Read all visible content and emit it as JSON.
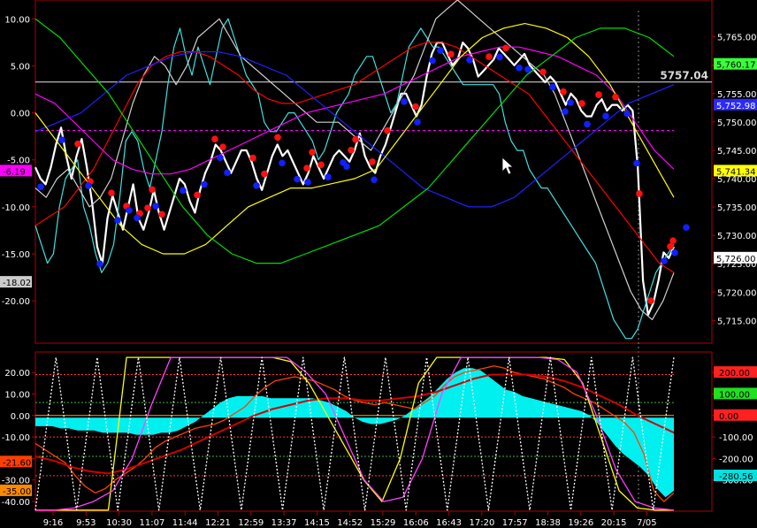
{
  "chart_data": [
    {
      "type": "line",
      "panel": "price",
      "left_axis": {
        "ticks": [
          "10.00",
          "5.00",
          "0.00",
          "-5.00",
          "-10.00",
          "-15.00",
          "-20.00"
        ],
        "values": [
          10,
          5,
          0,
          -5,
          -10,
          -15,
          -20
        ],
        "range": [
          -24.5,
          12
        ]
      },
      "right_axis": {
        "ticks": [
          "5,765.00",
          "5,760.00",
          "5,755.00",
          "5,750.00",
          "5,745.00",
          "5,740.00",
          "5,735.00",
          "5,730.00",
          "5,725.00",
          "5,720.00",
          "5,715.00"
        ],
        "values": [
          5765,
          5760,
          5755,
          5750,
          5745,
          5740,
          5735,
          5730,
          5725,
          5720,
          5715
        ],
        "range": [
          5711,
          5771.5
        ]
      },
      "x_ticks": [
        "9:16",
        "9:53",
        "10:30",
        "11:07",
        "11:44",
        "12:21",
        "12:59",
        "13:37",
        "14:15",
        "14:52",
        "15:29",
        "16:06",
        "16:43",
        "17:20",
        "17:57",
        "18:38",
        "19:26",
        "20:15",
        "7/05"
      ],
      "reference_level": 5757.04,
      "dashed_level": 5748.5,
      "value_labels": [
        {
          "text": "5757.04",
          "color": "#d8d8d8",
          "value": 5757.04,
          "boxed": false
        },
        {
          "text": "5,760.17",
          "color": "#3aff3a",
          "value": 5760.17
        },
        {
          "text": "5,752.98",
          "color": "#2a2aff",
          "value": 5752.98
        },
        {
          "text": "5,741.34",
          "color": "#ffff00",
          "value": 5741.34
        },
        {
          "text": "5,726.00",
          "color": "#ffffff",
          "value": 5726.0
        }
      ],
      "left_labels": [
        {
          "text": "-6.19",
          "color": "#ff00ff",
          "value": -6.19
        },
        {
          "text": "-18.02",
          "color": "#cccccc",
          "value": -18.02
        }
      ],
      "series": [
        {
          "color": "#ffffff",
          "role": "price",
          "values": [
            5742,
            5740,
            5739,
            5742,
            5746,
            5749,
            5744,
            5740,
            5744,
            5747,
            5742,
            5736,
            5728,
            5725,
            5733,
            5737,
            5734,
            5731,
            5735,
            5739,
            5733,
            5731,
            5734,
            5738,
            5734,
            5731,
            5734,
            5737,
            5740,
            5739,
            5736,
            5734,
            5738,
            5741,
            5743,
            5746,
            5745,
            5743,
            5741,
            5743,
            5745,
            5745,
            5743,
            5740,
            5738,
            5741,
            5744,
            5746,
            5744,
            5745,
            5743,
            5741,
            5739,
            5741,
            5744,
            5742,
            5740,
            5742,
            5744,
            5745,
            5744,
            5743,
            5745,
            5748,
            5744,
            5742,
            5741,
            5744,
            5746,
            5749,
            5752,
            5755,
            5755,
            5753,
            5751,
            5753,
            5758,
            5762,
            5764,
            5764,
            5762,
            5760,
            5761,
            5764,
            5763,
            5761,
            5758,
            5759,
            5760,
            5761,
            5763,
            5762,
            5761,
            5760,
            5761,
            5762,
            5760,
            5759,
            5758,
            5757,
            5758,
            5757,
            5755,
            5753,
            5755,
            5754,
            5752,
            5751,
            5751,
            5753,
            5754,
            5752,
            5753,
            5753,
            5752,
            5753,
            5752,
            5742,
            5722,
            5716,
            5718,
            5722,
            5727,
            5726,
            5728
          ]
        },
        {
          "color": "#40e0e0",
          "role": "left-scale",
          "values": [
            -12,
            -14,
            -16,
            -15,
            -10,
            -7,
            -6,
            -5,
            -10,
            -12,
            -15,
            -17,
            -16,
            -14,
            -9,
            -3,
            -2,
            -3,
            -6,
            -8,
            -5,
            -2,
            3,
            7,
            9,
            6,
            4,
            7,
            5,
            3,
            6,
            9,
            10,
            8,
            6,
            4,
            3,
            2,
            -1,
            -2,
            -2,
            -1,
            0,
            0,
            -1,
            -2,
            -3,
            -5,
            -4,
            -2,
            0,
            1,
            2,
            4,
            5,
            6,
            6,
            4,
            2,
            0,
            1,
            4,
            7,
            8,
            9,
            8,
            7,
            7,
            6,
            5,
            4,
            3,
            3,
            3,
            3,
            3,
            3,
            2,
            -1,
            -3,
            -4,
            -4,
            -6,
            -7,
            -8,
            -8,
            -9,
            -10,
            -11,
            -12,
            -13,
            -14,
            -15,
            -16,
            -18,
            -20,
            -22,
            -23,
            -24,
            -24,
            -23,
            -21,
            -19,
            -17,
            -16,
            -15,
            -14
          ]
        },
        {
          "color": "#d0d0d0",
          "role": "left-scale",
          "values": [
            -8,
            -9,
            -7,
            -6,
            -8,
            -10,
            -9,
            -7,
            -3,
            1,
            4,
            6,
            5,
            3,
            5,
            8,
            9,
            10,
            8,
            6,
            5,
            4,
            3,
            2,
            1,
            0,
            -1,
            -1,
            -1,
            -2,
            -3,
            -4,
            -2,
            0,
            2,
            4,
            7,
            10,
            11,
            12,
            11,
            10,
            9,
            8,
            7,
            6,
            5,
            4,
            2,
            -1,
            -4,
            -7,
            -10,
            -13,
            -16,
            -19,
            -21,
            -22,
            -20,
            -17
          ]
        },
        {
          "color": "#ff0000",
          "role": "left-scale",
          "values": [
            -12,
            -11,
            -10,
            -8,
            -6,
            -3,
            0,
            3,
            5,
            6,
            6.5,
            6.5,
            6,
            5,
            4,
            2.5,
            1.5,
            1,
            1,
            1.5,
            2,
            2.5,
            3,
            4,
            5,
            6,
            7,
            7.5,
            7.5,
            7,
            6,
            5,
            4,
            3,
            2,
            0,
            -2,
            -4,
            -6,
            -8,
            -10,
            -12,
            -14,
            -16,
            -17
          ]
        },
        {
          "color": "#ff00ff",
          "role": "left-scale",
          "values": [
            2,
            1,
            -1,
            -3,
            -5,
            -6,
            -6.5,
            -6.5,
            -6,
            -5,
            -4,
            -3,
            -2,
            -1,
            0,
            0.5,
            1,
            1.5,
            2,
            3,
            4,
            5,
            6,
            6.5,
            7,
            7,
            6.5,
            6,
            5,
            4,
            2,
            -1,
            -4,
            -6
          ]
        },
        {
          "color": "#2020ff",
          "role": "left-scale",
          "values": [
            -2,
            -1,
            0,
            2,
            4,
            5,
            6,
            6.5,
            6.5,
            6,
            5,
            4,
            2,
            0,
            -2,
            -4,
            -6,
            -8,
            -9,
            -10,
            -10,
            -9,
            -7,
            -5,
            -3,
            -1,
            1,
            2,
            3
          ]
        },
        {
          "color": "#ffff00",
          "role": "left-scale",
          "values": [
            0,
            -3,
            -6,
            -9,
            -12,
            -14,
            -15,
            -15,
            -14,
            -12,
            -10,
            -9,
            -8,
            -8,
            -7.5,
            -7,
            -6,
            -3,
            0,
            3,
            6,
            8,
            9,
            9.5,
            9,
            8,
            6,
            3,
            -1,
            -5,
            -9
          ]
        },
        {
          "color": "#00dd00",
          "role": "left-scale",
          "values": [
            10,
            8,
            5,
            2,
            -2,
            -6,
            -10,
            -13,
            -15,
            -16,
            -16,
            -15,
            -14,
            -13,
            -12,
            -10,
            -8,
            -5,
            -2,
            1,
            4,
            6,
            8,
            9,
            9,
            8,
            6
          ]
        }
      ],
      "markers_red_highs": [
        48,
        62,
        86,
        103,
        118,
        127,
        132,
        143,
        183,
        203,
        212,
        246,
        259,
        274,
        307,
        313,
        323,
        357,
        362,
        381,
        398,
        430,
        470,
        513,
        532,
        574,
        597,
        618,
        637,
        656,
        683,
        696,
        718,
        721
      ],
      "markers_blue_lows": [
        6,
        30,
        60,
        73,
        93,
        106,
        115,
        136,
        167,
        191,
        209,
        217,
        250,
        279,
        296,
        308,
        331,
        348,
        352,
        383,
        417,
        432,
        449,
        458,
        491,
        525,
        547,
        557,
        585,
        599,
        605,
        624,
        645,
        669,
        680,
        711,
        723,
        736
      ]
    },
    {
      "type": "line",
      "panel": "oscillator",
      "left_axis": {
        "ticks": [
          "20.00",
          "10.00",
          "0.00",
          "-10.00",
          "-20.00",
          "-30.00",
          "-40.00"
        ],
        "values": [
          20,
          10,
          0,
          -10,
          -20,
          -30,
          -40
        ],
        "range": [
          -44.5,
          29.5
        ]
      },
      "right_axis": {
        "ticks": [
          "200.00",
          "100.00",
          "0.00",
          "-100.00",
          "-200.00",
          "-300.00"
        ],
        "values": [
          200,
          100,
          0,
          -100,
          -200,
          -300
        ]
      },
      "reference_lines": [
        {
          "color": "#ffa500",
          "value": 0
        },
        {
          "color": "#ff3333",
          "value": 19,
          "dotted": true
        },
        {
          "color": "#ff3333",
          "value": -10,
          "dotted": true
        },
        {
          "color": "#ff3333",
          "value": -28,
          "dotted": true
        },
        {
          "color": "#40b040",
          "value": 6,
          "dotted": true
        },
        {
          "color": "#40b040",
          "value": -19,
          "dotted": true
        }
      ],
      "value_labels": [
        {
          "text": "200.00",
          "color": "#ff2020",
          "value": 200
        },
        {
          "text": "100.00",
          "color": "#20e020",
          "value": 100
        },
        {
          "text": "0.00",
          "color": "#ff2020",
          "value": 0
        },
        {
          "text": "-280.56",
          "color": "#00e0e0",
          "value": -280.56
        }
      ],
      "left_labels": [
        {
          "text": "-21.60",
          "color": "#ff4000",
          "value": -21.6
        },
        {
          "text": "-35.00",
          "color": "#ff8800",
          "value": -35
        }
      ],
      "histogram_cyan": [
        -5,
        -5,
        -5,
        -6,
        -6,
        -7,
        -7,
        -7,
        -8,
        -8,
        -8,
        -8,
        -9,
        -9,
        -9,
        -8,
        -8,
        -7,
        -5,
        -3,
        0,
        3,
        6,
        8,
        9,
        9,
        9,
        9,
        8,
        8,
        8,
        8,
        8,
        8,
        7,
        6,
        4,
        2,
        -1,
        -3,
        -4,
        -4,
        -3,
        -2,
        0,
        3,
        6,
        9,
        13,
        17,
        20,
        22,
        22,
        21,
        18,
        15,
        12,
        11,
        9,
        8,
        7,
        6,
        5,
        4,
        3,
        2,
        0,
        -4,
        -9,
        -14,
        -18,
        -21,
        -24,
        -28,
        -34,
        -38,
        -35
      ],
      "series": [
        {
          "color": "#ff4000",
          "role": "momentum",
          "values": [
            -13,
            -16,
            -19,
            -22,
            -28,
            -33,
            -36,
            -34,
            -30,
            -27,
            -24,
            -20,
            -15,
            -12,
            -10,
            -8,
            -6,
            -5,
            -4,
            -2,
            1,
            4,
            9,
            13,
            16,
            17,
            18,
            17,
            16,
            14,
            12,
            9,
            7,
            6,
            5,
            6,
            5,
            4,
            3,
            6,
            9,
            14,
            18,
            20,
            21,
            22,
            23,
            22,
            20,
            19,
            18,
            17,
            15,
            13,
            10,
            8,
            6,
            3,
            0,
            -3,
            -8,
            -18,
            -35,
            -40,
            -36
          ]
        },
        {
          "color": "#d00000",
          "role": "smooth",
          "values": [
            -19,
            -21,
            -24,
            -26,
            -27,
            -25,
            -22,
            -19,
            -16,
            -12,
            -8,
            -4,
            0,
            3,
            5,
            7,
            8,
            8,
            7,
            7,
            8,
            9,
            11,
            14,
            17,
            19,
            19,
            19,
            18,
            16,
            13,
            9,
            5,
            0,
            -4,
            -8
          ]
        },
        {
          "color": "#ffff00",
          "role": "stoch",
          "values": [
            -44,
            -44,
            -44,
            -44,
            -44,
            27,
            27,
            27,
            27,
            27,
            27,
            27,
            27,
            27,
            25,
            15,
            0,
            -15,
            -30,
            -40,
            -20,
            15,
            27,
            27,
            27,
            27,
            27,
            27,
            27,
            26,
            15,
            -10,
            -35,
            -43,
            -44,
            -44
          ]
        },
        {
          "color": "#ff40ff",
          "role": "stoch",
          "values": [
            -44,
            -44,
            -43,
            -40,
            -35,
            -20,
            5,
            27,
            27,
            27,
            27,
            27,
            27,
            27,
            20,
            10,
            -10,
            -30,
            -40,
            -38,
            -20,
            10,
            27,
            27,
            27,
            27,
            27,
            26,
            20,
            0,
            -25,
            -40,
            -43,
            -44
          ]
        },
        {
          "color": "#ffffff",
          "role": "dotted",
          "values": [
            -44,
            27,
            -44,
            27,
            -44,
            27,
            -44,
            27,
            -44,
            27,
            -44,
            27,
            -44,
            27,
            -44,
            27,
            -44,
            27,
            -44,
            27,
            -44,
            27,
            -44,
            27,
            -44,
            27,
            -44,
            27,
            -44,
            27,
            -44,
            27
          ]
        }
      ]
    }
  ],
  "cursor": {
    "icon": "mouse-pointer-icon"
  },
  "cross_marker": {
    "x_label": "7/05"
  }
}
